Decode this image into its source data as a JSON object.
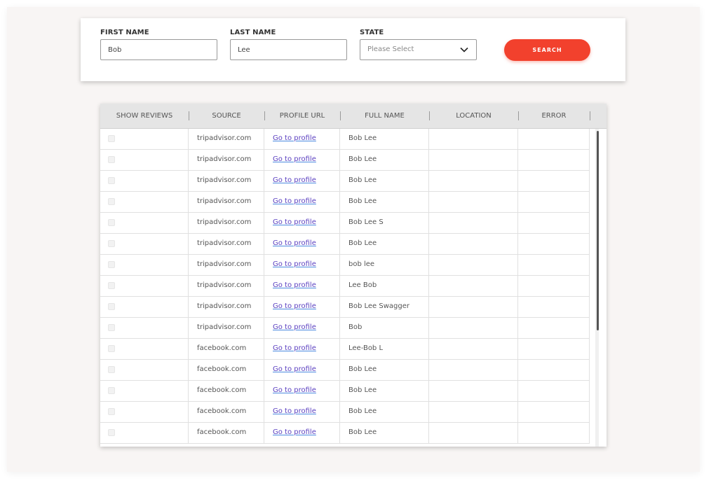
{
  "search": {
    "first_name_label": "FIRST NAME",
    "first_name_value": "Bob",
    "last_name_label": "LAST NAME",
    "last_name_value": "Lee",
    "state_label": "STATE",
    "state_placeholder": "Please Select",
    "search_button_label": "SEARCH"
  },
  "colors": {
    "accent": "#f2412d",
    "link": "#5a3fc0",
    "background": "#f8f5f4"
  },
  "table": {
    "headers": {
      "show_reviews": "SHOW REVIEWS",
      "source": "SOURCE",
      "profile_url": "PROFILE URL",
      "full_name": "FULL NAME",
      "location": "LOCATION",
      "error": "ERROR"
    },
    "rows": [
      {
        "source": "tripadvisor.com",
        "profile": "Go to profile",
        "name": "Bob Lee",
        "location": "",
        "error": ""
      },
      {
        "source": "tripadvisor.com",
        "profile": "Go to profile",
        "name": "Bob Lee",
        "location": "",
        "error": ""
      },
      {
        "source": "tripadvisor.com",
        "profile": "Go to profile",
        "name": "Bob Lee",
        "location": "",
        "error": ""
      },
      {
        "source": "tripadvisor.com",
        "profile": "Go to profile",
        "name": "Bob Lee",
        "location": "",
        "error": ""
      },
      {
        "source": "tripadvisor.com",
        "profile": "Go to profile",
        "name": "Bob Lee S",
        "location": "",
        "error": ""
      },
      {
        "source": "tripadvisor.com",
        "profile": "Go to profile",
        "name": "Bob Lee",
        "location": "",
        "error": ""
      },
      {
        "source": "tripadvisor.com",
        "profile": "Go to profile",
        "name": "bob lee",
        "location": "",
        "error": ""
      },
      {
        "source": "tripadvisor.com",
        "profile": "Go to profile",
        "name": "Lee Bob",
        "location": "",
        "error": ""
      },
      {
        "source": "tripadvisor.com",
        "profile": "Go to profile",
        "name": "Bob Lee Swagger",
        "location": "",
        "error": ""
      },
      {
        "source": "tripadvisor.com",
        "profile": "Go to profile",
        "name": "Bob",
        "location": "",
        "error": ""
      },
      {
        "source": "facebook.com",
        "profile": "Go to profile",
        "name": "Lee-Bob L",
        "location": "",
        "error": ""
      },
      {
        "source": "facebook.com",
        "profile": "Go to profile",
        "name": "Bob Lee",
        "location": "",
        "error": ""
      },
      {
        "source": "facebook.com",
        "profile": "Go to profile",
        "name": "Bob Lee",
        "location": "",
        "error": ""
      },
      {
        "source": "facebook.com",
        "profile": "Go to profile",
        "name": "Bob Lee",
        "location": "",
        "error": ""
      },
      {
        "source": "facebook.com",
        "profile": "Go to profile",
        "name": "Bob Lee",
        "location": "",
        "error": ""
      }
    ]
  }
}
